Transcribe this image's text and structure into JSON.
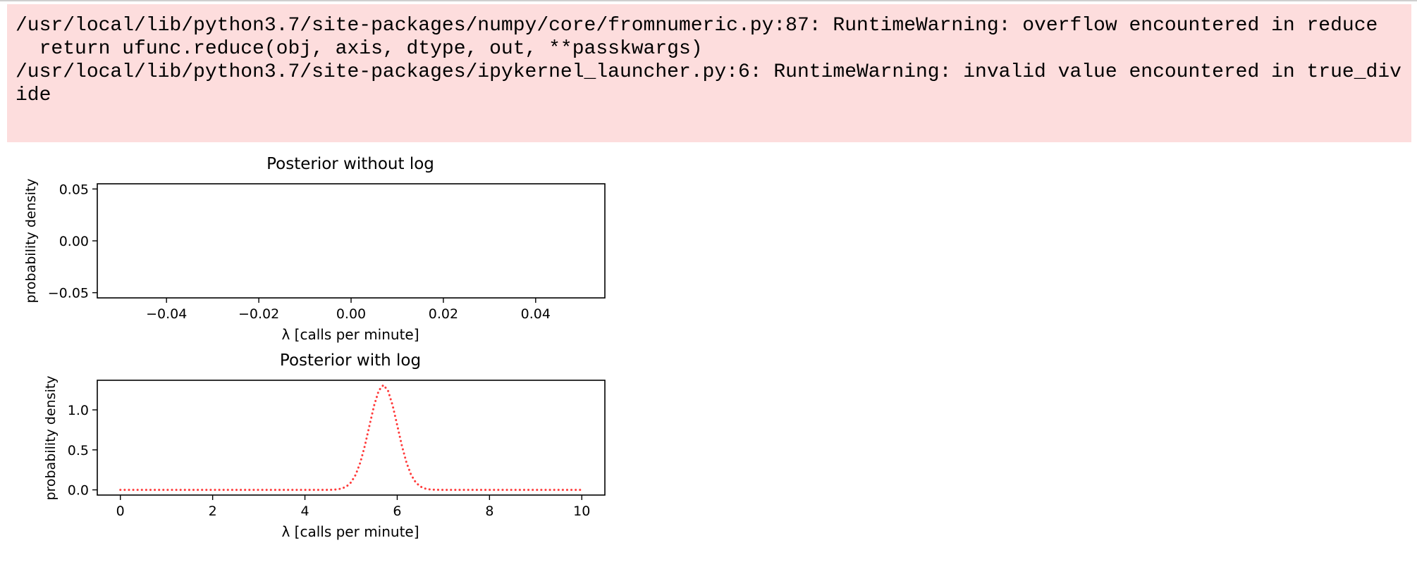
{
  "stderr": {
    "lines": [
      "/usr/local/lib/python3.7/site-packages/numpy/core/fromnumeric.py:87: RuntimeWarning: overflow encountered in reduce",
      "  return ufunc.reduce(obj, axis, dtype, out, **passkwargs)",
      "/usr/local/lib/python3.7/site-packages/ipykernel_launcher.py:6: RuntimeWarning: invalid value encountered in true_div",
      "ide"
    ],
    "background": "#fddddd"
  },
  "chart_data": [
    {
      "type": "line",
      "title": "Posterior without log",
      "xlabel": "λ [calls per minute]",
      "ylabel": "probability density",
      "xlim": [
        -0.055,
        0.055
      ],
      "ylim": [
        -0.055,
        0.055
      ],
      "xticks": [
        -0.04,
        -0.02,
        0.0,
        0.02,
        0.04
      ],
      "xtick_labels": [
        "−0.04",
        "−0.02",
        "0.00",
        "0.02",
        "0.04"
      ],
      "yticks": [
        0.05,
        0.0,
        -0.05
      ],
      "ytick_labels": [
        "0.05",
        "0.00",
        "−0.05"
      ],
      "grid": false,
      "series": []
    },
    {
      "type": "line",
      "title": "Posterior with log",
      "xlabel": "λ [calls per minute]",
      "ylabel": "probability density",
      "xlim": [
        -0.5,
        10.5
      ],
      "ylim": [
        -0.065,
        1.37
      ],
      "xticks": [
        0,
        2,
        4,
        6,
        8,
        10
      ],
      "xtick_labels": [
        "0",
        "2",
        "4",
        "6",
        "8",
        "10"
      ],
      "yticks": [
        1.0,
        0.5,
        0.0
      ],
      "ytick_labels": [
        "1.0",
        "0.5",
        "0.0"
      ],
      "grid": false,
      "series": [
        {
          "color": "#ff3b3b",
          "linestyle": "dotted",
          "curve": "gaussian",
          "mean": 5.7,
          "sd": 0.305,
          "peak": 1.31,
          "x_start": 0,
          "x_end": 10,
          "n_points": 101
        }
      ]
    }
  ]
}
